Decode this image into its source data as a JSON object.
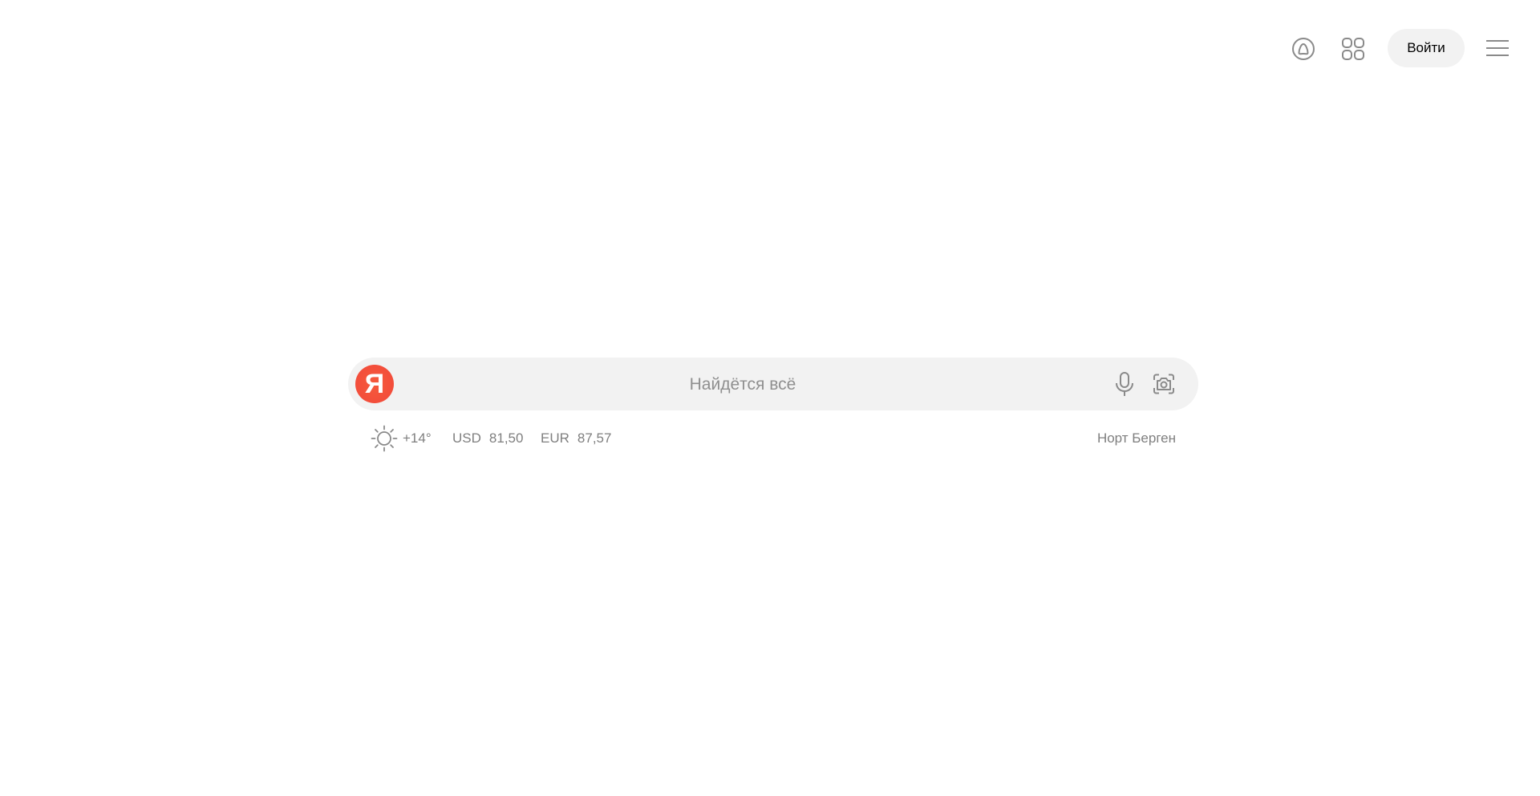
{
  "header": {
    "login_label": "Войти",
    "icons": [
      "alice-icon",
      "apps-grid-icon",
      "menu-icon"
    ]
  },
  "search": {
    "placeholder": "Найдётся всё",
    "logo_letter": "Я",
    "icons": [
      "microphone-icon",
      "camera-icon"
    ]
  },
  "info": {
    "weather": {
      "icon": "sun-icon",
      "temperature": "+14°"
    },
    "rates": [
      {
        "currency": "USD",
        "value": "81,50"
      },
      {
        "currency": "EUR",
        "value": "87,57"
      }
    ],
    "city": "Норт Берген"
  },
  "colors": {
    "brand_red": "#fc3f1d",
    "search_bg": "#f2f2f2",
    "muted_text": "#7f7f7f"
  }
}
